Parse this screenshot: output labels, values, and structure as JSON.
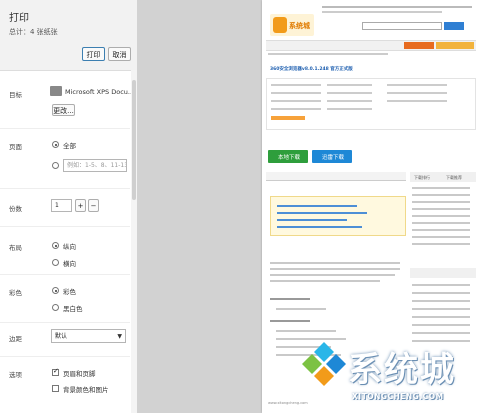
{
  "dialog": {
    "title": "打印",
    "sheet_count": "总计：4 张纸张",
    "print_button": "打印",
    "cancel_button": "取消"
  },
  "destination": {
    "label": "目标",
    "printer_name": "Microsoft XPS Docu...",
    "change_button": "更改..."
  },
  "pages": {
    "label": "页面",
    "all_option": "全部",
    "range_placeholder": "例如：1-5、8、11-13"
  },
  "copies": {
    "label": "份数",
    "value": "1",
    "plus": "+",
    "minus": "−"
  },
  "layout": {
    "label": "布局",
    "portrait": "纵向",
    "landscape": "横向"
  },
  "color": {
    "label": "彩色",
    "color_option": "彩色",
    "bw_option": "黑白色"
  },
  "margins": {
    "label": "边距",
    "value": "默认"
  },
  "options": {
    "label": "选项",
    "header_footer": "页眉和页脚",
    "background": "背景颜色和图片"
  },
  "preview": {
    "site_name": "系统城",
    "article_title": "360安全浏览器v8.0.1.248 官方正式版",
    "download_local": "本地下载",
    "download_fast": "迅雷下载",
    "sidebar_tab1": "下载排行",
    "sidebar_tab2": "下载推荐",
    "footer_url": "www.xitongcheng.com"
  },
  "watermark": {
    "text": "系统城",
    "url": "XITONGCHENG.COM"
  },
  "colors": {
    "accent_blue": "#1e88d6",
    "download_green": "#2e9e3c",
    "logo_orange": "#f29b1a",
    "logo_cyan": "#29b6e8",
    "logo_green": "#7cc243"
  }
}
